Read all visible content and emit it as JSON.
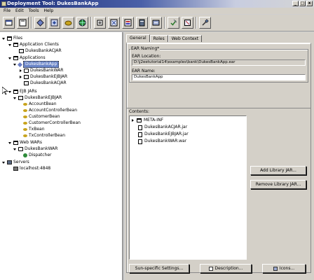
{
  "window": {
    "title": "Deployment Tool: DukesBankApp",
    "min": "_",
    "max": "□",
    "close": "x"
  },
  "menu": [
    "File",
    "Edit",
    "Tools",
    "Help"
  ],
  "tree": {
    "files": "Files",
    "app_clients": "Application Clients",
    "dukes_acjar_1": "DukesBankACJAR",
    "applications": "Applications",
    "dukes_app": "DukesBankApp",
    "dukes_war": "DukesBankWAR",
    "dukes_ejbjar": "DukesBankEJBJAR",
    "dukes_acjar_2": "DukesBankACJAR",
    "ejb_jars": "EJB JARs",
    "ejbjar_root": "DukesBankEJBJAR",
    "beans": [
      "AccountBean",
      "AccountControllerBean",
      "CustomerBean",
      "CustomerControllerBean",
      "TxBean",
      "TxControllerBean"
    ],
    "web_wars": "Web WARs",
    "war_root": "DukesBankWAR",
    "dispatcher": "Dispatcher",
    "servers": "Servers",
    "localhost": "localhost:4848"
  },
  "tabs": [
    "General",
    "Roles",
    "Web Context"
  ],
  "general": {
    "ear_naming_label": "EAR Naming*",
    "ear_location_label": "EAR Location:",
    "ear_location_value": "D:\\j2eetutorial14\\examples\\bank\\DukesBankApp.ear",
    "ear_name_label": "EAR Name:",
    "ear_name_value": "DukesBankApp",
    "contents_label": "Contents:",
    "contents_root": "META-INF",
    "contents_items": [
      "DukesBankACJAR.jar",
      "DukesBankEJBJAR.jar",
      "DukesBankWAR.war"
    ],
    "add_library_jar": "Add Library JAR...",
    "remove_library_jar": "Remove Library JAR..."
  },
  "footer": {
    "sun_specific": "Sun-specific Settings...",
    "description": "Description...",
    "icons": "Icons..."
  }
}
